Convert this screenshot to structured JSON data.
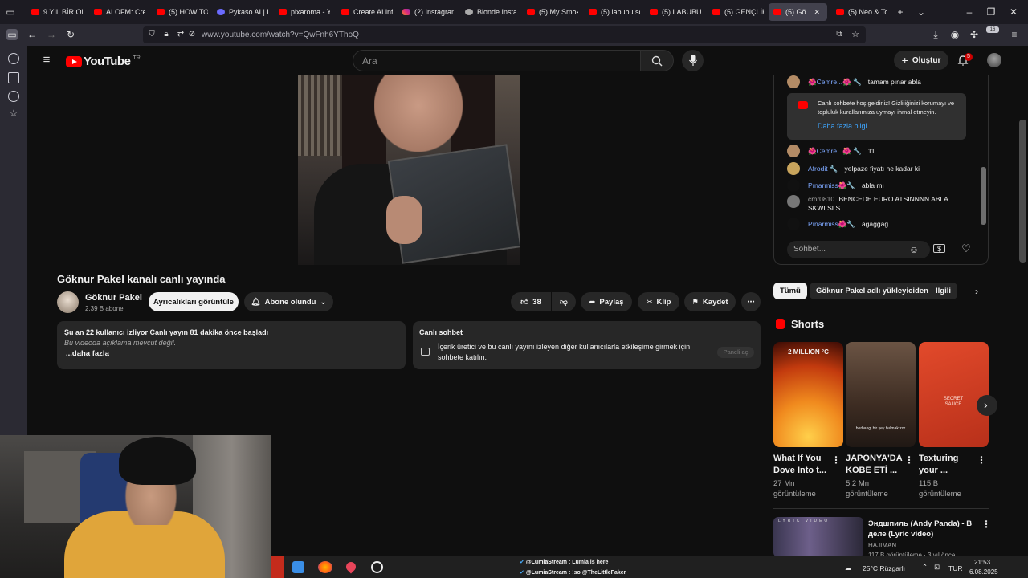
{
  "browser": {
    "tabs": [
      {
        "label": "9 YIL BİR OD",
        "icon": "youtube"
      },
      {
        "label": "AI OFM: Crea",
        "icon": "youtube"
      },
      {
        "label": "(5) HOW TO I",
        "icon": "youtube"
      },
      {
        "label": "Pykaso AI | Pr",
        "icon": "ai"
      },
      {
        "label": "pixaroma - Yo",
        "icon": "youtube"
      },
      {
        "label": "Create AI infl",
        "icon": "youtube"
      },
      {
        "label": "(2) Instagram",
        "icon": "instagram"
      },
      {
        "label": "Blonde Instag",
        "icon": "round"
      },
      {
        "label": "(5) My Smoki",
        "icon": "youtube"
      },
      {
        "label": "(5) labubu so",
        "icon": "youtube"
      },
      {
        "label": "(5) LABUBU D",
        "icon": "youtube"
      },
      {
        "label": "(5) GENÇLİK E",
        "icon": "youtube"
      },
      {
        "label": "(5) Gö",
        "icon": "youtube"
      },
      {
        "label": "(5) Neo & Toy",
        "icon": "youtube"
      }
    ],
    "active_tab_index": 12,
    "url": "www.youtube.com/watch?v=QwFnh6YThoQ",
    "extensions_badge": "16"
  },
  "youtube": {
    "logo_text": "YouTube",
    "country_code": "TR",
    "search_placeholder": "Ara",
    "create_label": "Oluştur",
    "notifications_count": "5"
  },
  "video": {
    "title": "Göknur Pakel kanalı canlı yayında",
    "channel_name": "Göknur Pakel",
    "subscribers": "2,39 B abone",
    "perks_button": "Ayrıcalıkları görüntüle",
    "subscribed_button": "Abone olundu",
    "likes": "38",
    "share_label": "Paylaş",
    "clip_label": "Klip",
    "save_label": "Kaydet"
  },
  "description": {
    "line1": "Şu an 22 kullanıcı izliyor  Canlı yayın 81 dakika önce başladı",
    "line2": "Bu videoda açıklama mevcut değil.",
    "more": "...daha fazla"
  },
  "live_chat_box": {
    "title": "Canlı sohbet",
    "body": "İçerik üretici ve bu canlı yayını izleyen diğer kullanıcılarla etkileşime girmek için sohbete katılın.",
    "button": "Paneli aç"
  },
  "chat": {
    "messages": [
      {
        "author": "🌺Cemre...🌺 🔧",
        "text": "tamam pınar abla"
      },
      {
        "author": "🌺Cemre...🌺 🔧",
        "text": "11"
      },
      {
        "author": "Afrodit 🔧",
        "text": "yelpaze fiyatı ne kadar ki"
      },
      {
        "author": "Pınarmiss🌺🔧",
        "text": "abla mı"
      },
      {
        "author": "cmr0810",
        "text": "BENCEDE EURO ATSINNNN ABLA SKWLSLS"
      },
      {
        "author": "Pınarmiss🌺🔧",
        "text": "agaggag"
      }
    ],
    "welcome_text": "Canlı sohbete hoş geldiniz! Gizliliğinizi korumayı ve topluluk kurallarımıza uymayı ihmal etmeyin.",
    "welcome_link": "Daha fazla bilgi",
    "input_placeholder": "Sohbet..."
  },
  "chips": [
    "Tümü",
    "Göknur Pakel adlı yükleyiciden",
    "İlgili"
  ],
  "shorts": {
    "title": "Shorts",
    "items": [
      {
        "title_l1": "What If You",
        "title_l2": "Dove Into t...",
        "views_l1": "27 Mn",
        "views_l2": "görüntüleme",
        "overlay": "2 MILLION °C"
      },
      {
        "title_l1": "JAPONYA'DA",
        "title_l2": "KOBE ETİ ...",
        "views_l1": "5,2 Mn",
        "views_l2": "görüntüleme",
        "overlay": "herhangi bir şey bulmak zor"
      },
      {
        "title_l1": "Texturing",
        "title_l2": "your ...",
        "views_l1": "115 B",
        "views_l2": "görüntüleme",
        "overlay": "SECRET SAUCE"
      }
    ]
  },
  "recommended": {
    "title": "Эндшпиль (Andy Panda) - В деле (Lyric video)",
    "channel": "HAJIMAN",
    "meta": "117 B görüntüleme · 3 yıl önce",
    "thumb_text": "LYRIC VIDEO"
  },
  "taskbar": {
    "ticker1_user": "@LumiaStream",
    "ticker1_text": ": Lumia is here",
    "ticker2_user": "@LumiaStream",
    "ticker2_text": ": !so @TheLittleFaker",
    "weather": "25°C  Rüzgarlı",
    "language": "TUR",
    "time": "21:53",
    "date": "6.08.2025"
  }
}
